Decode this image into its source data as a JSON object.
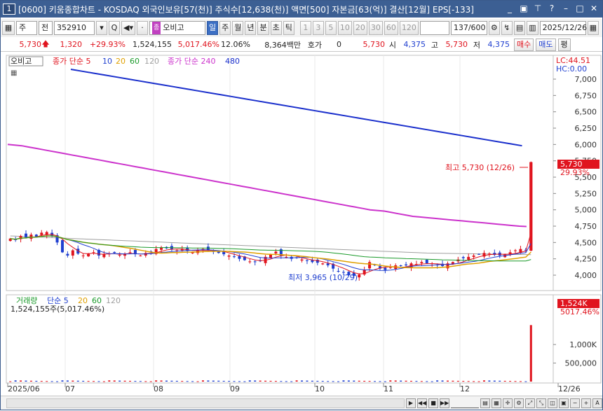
{
  "window": {
    "number": "1",
    "title": "[0600] 키움종합차트 - KOSDAQ 외국인보유[57(천)] 주식수[12,638(천)] 액면[500] 자본금[63(억)] 결산[12월] EPS[-133]"
  },
  "toolbar": {
    "period_type": "주",
    "market": "전",
    "code": "352910",
    "stock_name": "오비고",
    "periods": [
      "일",
      "주",
      "월",
      "년",
      "분",
      "초",
      "틱"
    ],
    "selected_period": "일",
    "intervals": [
      "1",
      "3",
      "5",
      "10",
      "20",
      "30",
      "60",
      "120"
    ],
    "count": "137/600",
    "date": "2025/12/26"
  },
  "quote": {
    "price": "5,730",
    "change": "1,320",
    "change_pct": "+29.93%",
    "volume": "1,524,155",
    "volume_pct": "5,017.46%",
    "turnover": "12.06%",
    "amount": "8,364백만",
    "hoga_label": "호가",
    "hoga_value": "0",
    "hoga_price": "5,730",
    "open_label": "시",
    "open": "4,375",
    "high_label": "고",
    "high": "5,730",
    "low_label": "저",
    "low": "4,375",
    "buy_label": "매수",
    "sell_label": "매도",
    "eval_label": "평"
  },
  "chart_data": [
    {
      "type": "candlestick",
      "name_label": "오비고",
      "legend": [
        "종가 단순 5",
        "10",
        "20",
        "60",
        "120",
        "종가 단순 240",
        "480"
      ],
      "legend_colors": [
        "#e0141e",
        "#1f3fd0",
        "#e0a000",
        "#1a9a2a",
        "#a0a0a0",
        "#cc33cc",
        "#1a2fcc"
      ],
      "lc_label": "LC:44.51",
      "hc_label": "HC:0.00",
      "y_ticks": [
        "7,000",
        "6,750",
        "6,500",
        "6,250",
        "6,000",
        "5,750",
        "5,500",
        "5,250",
        "5,000",
        "4,750",
        "4,500",
        "4,250",
        "4,000"
      ],
      "ylim": [
        3850,
        7300
      ],
      "last_price_label": "5,730",
      "last_pct_label": "29.93%",
      "high_annotation": "최고 5,730 (12/26)",
      "low_annotation": "최저 3,965 (10/29)",
      "close": [
        4560,
        4540,
        4600,
        4580,
        4620,
        4590,
        4650,
        4660,
        4600,
        4500,
        4350,
        4300,
        4380,
        4330,
        4300,
        4330,
        4350,
        4300,
        4320,
        4330,
        4340,
        4310,
        4330,
        4350,
        4320,
        4300,
        4340,
        4360,
        4400,
        4420,
        4410,
        4390,
        4380,
        4400,
        4370,
        4350,
        4380,
        4400,
        4390,
        4360,
        4340,
        4320,
        4300,
        4280,
        4250,
        4230,
        4210,
        4200,
        4220,
        4280,
        4320,
        4360,
        4300,
        4280,
        4250,
        4260,
        4240,
        4220,
        4200,
        4190,
        4180,
        4150,
        4100,
        4060,
        4040,
        4000,
        3990,
        4010,
        4080,
        4200,
        4150,
        4100,
        4080,
        4120,
        4150,
        4140,
        4150,
        4180,
        4170,
        4200,
        4180,
        4160,
        4150,
        4140,
        4180,
        4200,
        4240,
        4260,
        4280,
        4300,
        4320,
        4340,
        4330,
        4310,
        4300,
        4320,
        4350,
        4380,
        4400,
        4380,
        5730
      ],
      "ma240": [
        6000,
        5990,
        5980,
        5960,
        5940,
        5920,
        5900,
        5880,
        5860,
        5840,
        5820,
        5800,
        5780,
        5760,
        5740,
        5720,
        5700,
        5680,
        5660,
        5640,
        5620,
        5600,
        5580,
        5560,
        5540,
        5520,
        5500,
        5480,
        5460,
        5440,
        5420,
        5400,
        5380,
        5360,
        5340,
        5320,
        5300,
        5280,
        5260,
        5240,
        5220,
        5200,
        5180,
        5160,
        5140,
        5120,
        5100,
        5080,
        5060,
        5040,
        5020,
        5000,
        4990,
        4980,
        4960,
        4940,
        4920,
        4900,
        4890,
        4880,
        4870,
        4860,
        4850,
        4840,
        4830,
        4820,
        4810,
        4800,
        4790,
        4780,
        4770,
        4760,
        4750,
        4745
      ],
      "ma480": [
        7150,
        7120,
        7090,
        7060,
        7030,
        7000,
        6970,
        6940,
        6910,
        6880,
        6850,
        6820,
        6790,
        6760,
        6730,
        6700,
        6670,
        6640,
        6610,
        6580,
        6550,
        6520,
        6490,
        6460,
        6430,
        6400,
        6370,
        6340,
        6310,
        6280,
        6250,
        6220,
        6190,
        6160,
        6130,
        6100,
        6070,
        6040,
        6010,
        5980
      ]
    },
    {
      "type": "bar",
      "legend": [
        "거래량",
        "단순 5",
        "20",
        "60",
        "120"
      ],
      "legend_colors": [
        "#1a9a2a",
        "#1f3fd0",
        "#e0a000",
        "#1a9a2a",
        "#a0a0a0"
      ],
      "volume_label": "1,524,155주(5,017.46%)",
      "y_ticks": [
        "1,000K",
        "500,000"
      ],
      "last_volume_label": "1,524K",
      "last_pct_label": "5017.46%",
      "last_volume": 1524155
    }
  ],
  "x_axis": {
    "ticks": [
      "2025/06",
      "07",
      "08",
      "09",
      "10",
      "11",
      "12",
      "12/26"
    ]
  }
}
